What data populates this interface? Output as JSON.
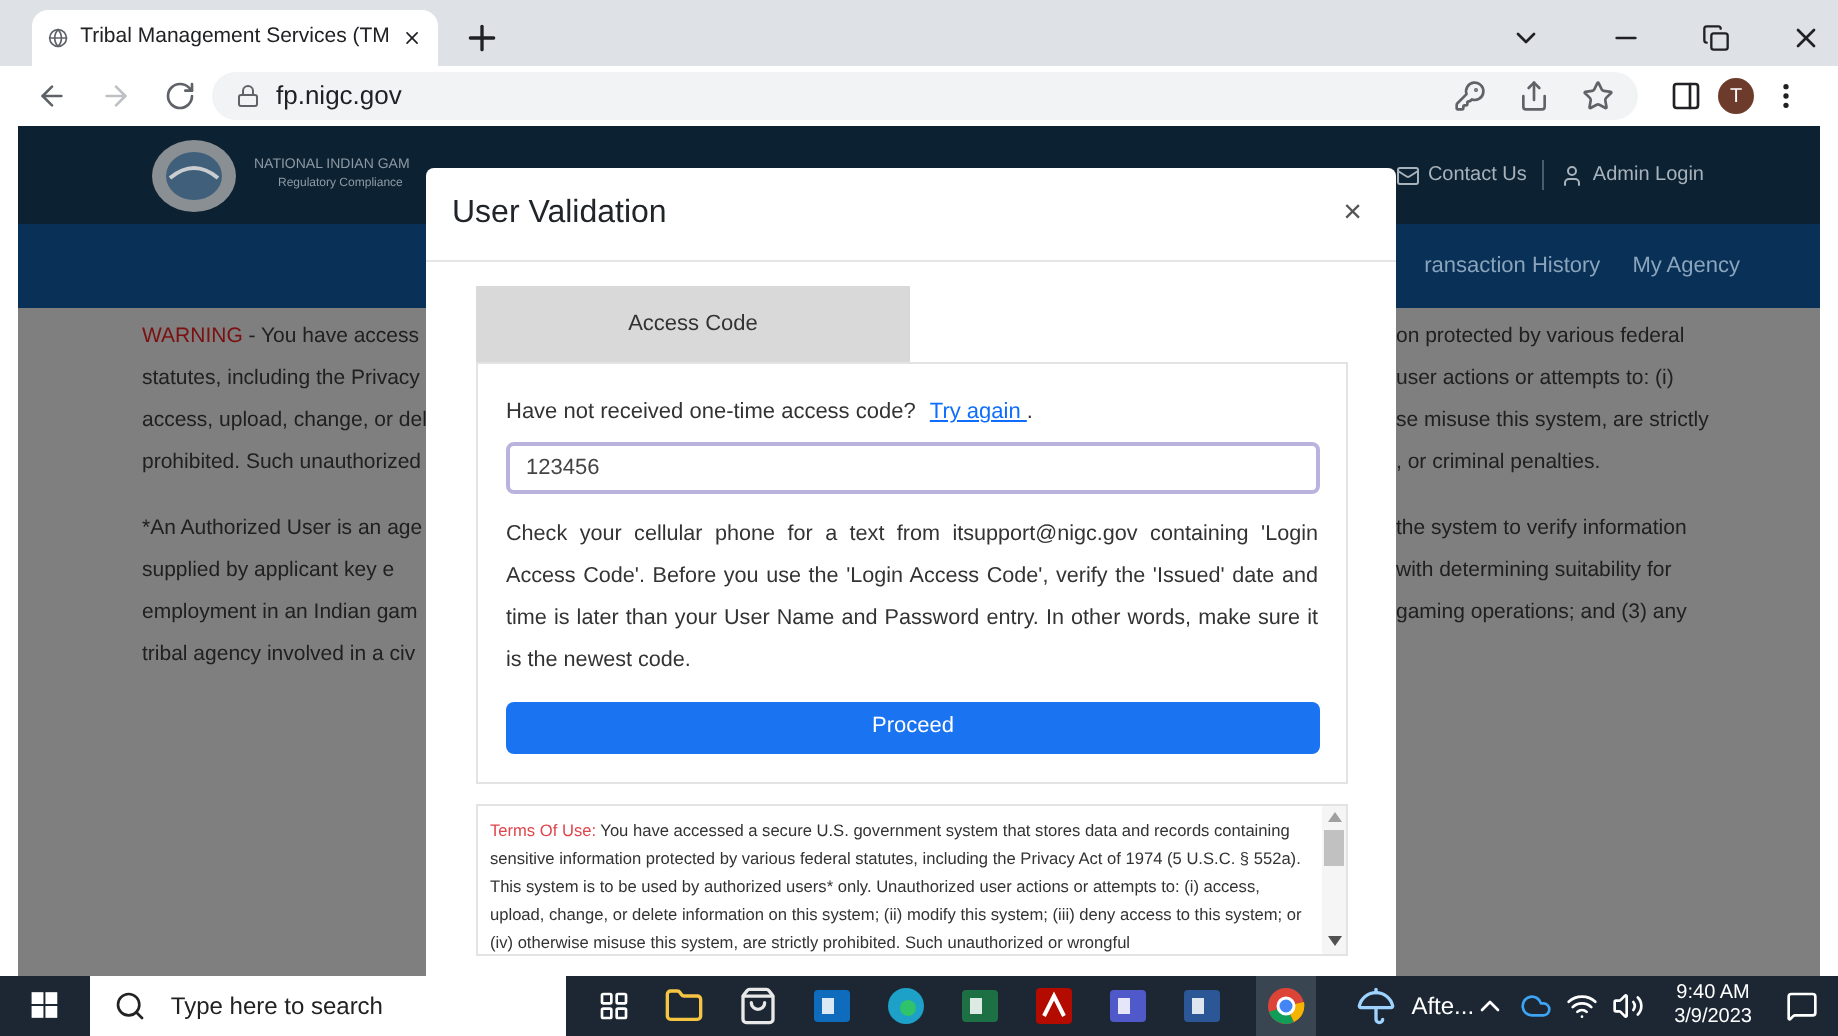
{
  "browser": {
    "tab_title": "Tribal Management Services (TM",
    "url": "fp.nigc.gov",
    "profile_initial": "T"
  },
  "site": {
    "org_name": "NATIONAL INDIAN GAM",
    "tagline": "Regulatory Compliance",
    "header_links": [
      {
        "label": "Contact Us",
        "kind": "mail"
      },
      {
        "label": "Admin Login",
        "kind": "user"
      }
    ],
    "nav": [
      "ransaction History",
      "My Agency"
    ],
    "warning_left": [
      {
        "lead": "WARNING",
        "text": " - You have access"
      },
      {
        "text": "statutes, including the Privacy"
      },
      {
        "text": "access, upload, change, or del"
      },
      {
        "text": "prohibited. Such unauthorized"
      }
    ],
    "authorized_left": [
      "*An Authorized User is an age",
      "supplied by applicant key e",
      "employment in an Indian gam",
      "tribal agency involved in a civ"
    ],
    "warning_right": [
      "on protected by various federal",
      "user actions or attempts to: (i)",
      "se misuse this system, are strictly",
      ", or criminal penalties."
    ],
    "authorized_right": [
      "the system to verify information",
      "with determining suitability for",
      "gaming operations; and (3) any"
    ]
  },
  "modal": {
    "title": "User Validation",
    "close": "×",
    "tabs": [
      {
        "label": "Access Code",
        "selected": true
      }
    ],
    "prompt": "Have not received one-time access code?",
    "link": "Try again ",
    "after_link": ".",
    "code_value": "123456",
    "instructions": "Check your cellular phone for a text from itsupport@nigc.gov containing 'Login Access Code'. Before you use the 'Login Access Code', verify the 'Issued' date and time is later than your User Name and Password entry. In other words, make sure it is the newest code.",
    "button": "Proceed",
    "terms_label": "Terms Of Use:",
    "terms_text": " You have accessed a secure U.S. government system that stores data and records containing sensitive information protected by various federal statutes, including the Privacy Act of 1974 (5 U.S.C. § 552a). This system is to be used by authorized users* only. Unauthorized user actions or attempts to: (i) access, upload, change, or delete information on this system; (ii) modify this system; (iii) deny access to this system; or (iv) otherwise misuse this system, are strictly prohibited. Such unauthorized or wrongful"
  },
  "taskbar": {
    "search_placeholder": "Type here to search",
    "weather": "Afte...",
    "time": "9:40 AM",
    "date": "3/9/2023"
  }
}
